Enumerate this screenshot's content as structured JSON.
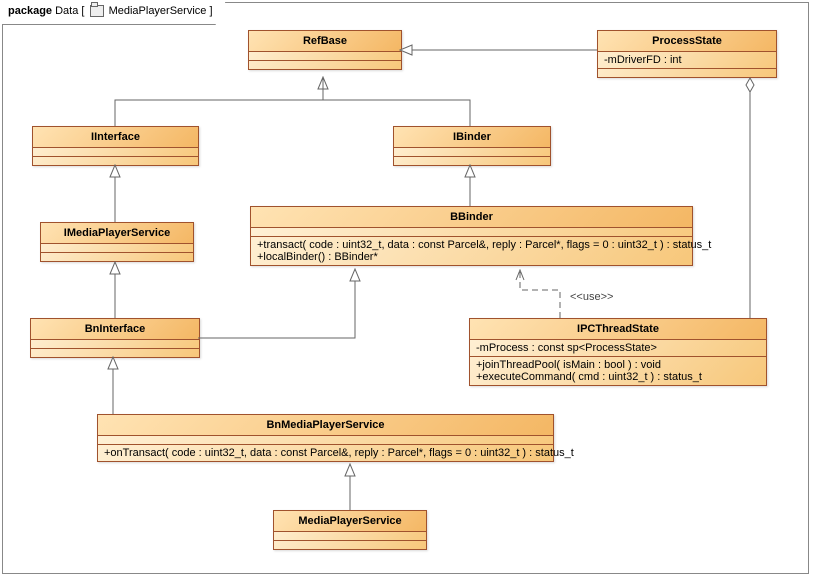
{
  "package": {
    "label_prefix": "package",
    "name": "Data",
    "stereotype_name": "MediaPlayerService"
  },
  "classes": {
    "RefBase": {
      "name": "RefBase"
    },
    "ProcessState": {
      "name": "ProcessState",
      "attr1": "-mDriverFD : int"
    },
    "IInterface": {
      "name": "IInterface"
    },
    "IBinder": {
      "name": "IBinder"
    },
    "IMediaPlayerService": {
      "name": "IMediaPlayerService"
    },
    "BBinder": {
      "name": "BBinder",
      "op1": "+transact( code : uint32_t, data : const Parcel&, reply : Parcel*, flags = 0 : uint32_t ) : status_t",
      "op2": "+localBinder() : BBinder*"
    },
    "BnInterface": {
      "name": "BnInterface"
    },
    "IPCThreadState": {
      "name": "IPCThreadState",
      "attr1": "-mProcess : const sp<ProcessState>",
      "op1": "+joinThreadPool( isMain : bool ) : void",
      "op2": "+executeCommand( cmd : uint32_t ) : status_t"
    },
    "BnMediaPlayerService": {
      "name": "BnMediaPlayerService",
      "op1": "+onTransact( code : uint32_t, data : const Parcel&, reply : Parcel*, flags = 0 : uint32_t ) : status_t"
    },
    "MediaPlayerService": {
      "name": "MediaPlayerService"
    }
  },
  "labels": {
    "use": "<<use>>"
  },
  "chart_data": {
    "type": "uml_class_diagram",
    "package": "Data",
    "diagram_name": "MediaPlayerService",
    "classes": [
      {
        "name": "RefBase",
        "attributes": [],
        "operations": []
      },
      {
        "name": "ProcessState",
        "attributes": [
          "-mDriverFD : int"
        ],
        "operations": []
      },
      {
        "name": "IInterface",
        "attributes": [],
        "operations": []
      },
      {
        "name": "IBinder",
        "attributes": [],
        "operations": []
      },
      {
        "name": "IMediaPlayerService",
        "attributes": [],
        "operations": []
      },
      {
        "name": "BBinder",
        "attributes": [],
        "operations": [
          "+transact( code : uint32_t, data : const Parcel&, reply : Parcel*, flags = 0 : uint32_t ) : status_t",
          "+localBinder() : BBinder*"
        ]
      },
      {
        "name": "BnInterface",
        "attributes": [],
        "operations": []
      },
      {
        "name": "IPCThreadState",
        "attributes": [
          "-mProcess : const sp<ProcessState>"
        ],
        "operations": [
          "+joinThreadPool( isMain : bool ) : void",
          "+executeCommand( cmd : uint32_t ) : status_t"
        ]
      },
      {
        "name": "BnMediaPlayerService",
        "attributes": [],
        "operations": [
          "+onTransact( code : uint32_t, data : const Parcel&, reply : Parcel*, flags = 0 : uint32_t ) : status_t"
        ]
      },
      {
        "name": "MediaPlayerService",
        "attributes": [],
        "operations": []
      }
    ],
    "relationships": [
      {
        "from": "IInterface",
        "to": "RefBase",
        "type": "generalization"
      },
      {
        "from": "IBinder",
        "to": "RefBase",
        "type": "generalization"
      },
      {
        "from": "ProcessState",
        "to": "RefBase",
        "type": "generalization"
      },
      {
        "from": "IMediaPlayerService",
        "to": "IInterface",
        "type": "generalization"
      },
      {
        "from": "BBinder",
        "to": "IBinder",
        "type": "generalization"
      },
      {
        "from": "BnInterface",
        "to": "IMediaPlayerService",
        "type": "generalization"
      },
      {
        "from": "BnInterface",
        "to": "BBinder",
        "type": "generalization"
      },
      {
        "from": "BnMediaPlayerService",
        "to": "BnInterface",
        "type": "generalization"
      },
      {
        "from": "MediaPlayerService",
        "to": "BnMediaPlayerService",
        "type": "generalization"
      },
      {
        "from": "IPCThreadState",
        "to": "BBinder",
        "type": "dependency",
        "stereotype": "use"
      },
      {
        "from": "IPCThreadState",
        "to": "ProcessState",
        "type": "aggregation"
      }
    ]
  }
}
